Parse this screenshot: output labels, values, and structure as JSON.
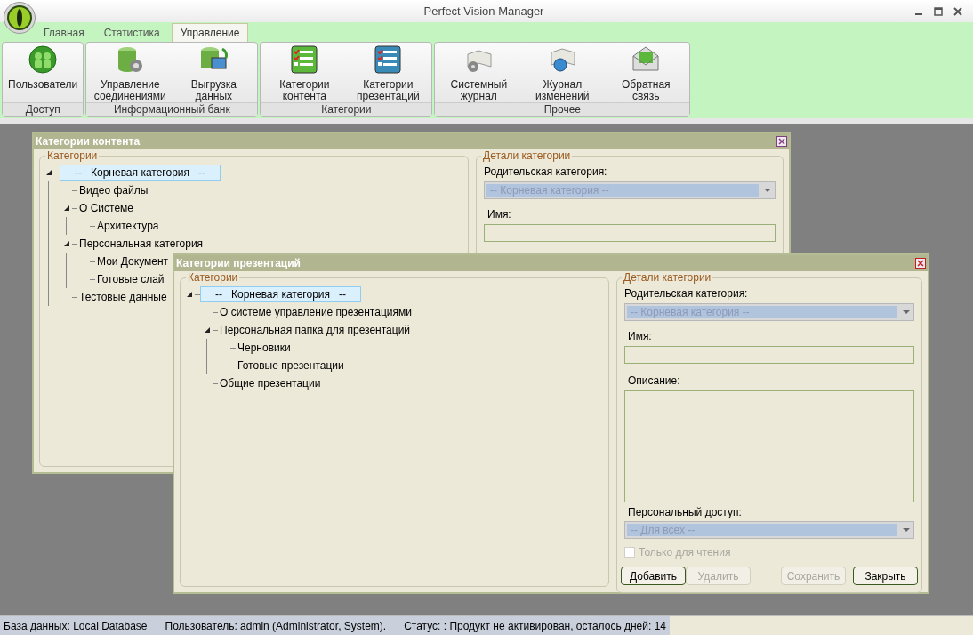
{
  "window": {
    "title": "Perfect Vision Manager"
  },
  "tabs": [
    {
      "label": "Главная",
      "selected": false
    },
    {
      "label": "Статистика",
      "selected": false
    },
    {
      "label": "Управление",
      "selected": true
    }
  ],
  "ribbon": [
    {
      "label": "Доступ",
      "buttons": [
        {
          "kind": "users",
          "label": "Пользователи"
        }
      ]
    },
    {
      "label": "Информационный банк",
      "buttons": [
        {
          "kind": "db-gear",
          "label": "Управление соединениями"
        },
        {
          "kind": "db-export",
          "label": "Выгрузка данных"
        }
      ]
    },
    {
      "label": "Категории",
      "buttons": [
        {
          "kind": "list-green",
          "label": "Категории контента"
        },
        {
          "kind": "list-blue",
          "label": "Категории презентаций"
        }
      ]
    },
    {
      "label": "Прочее",
      "buttons": [
        {
          "kind": "log",
          "label": "Системный журнал"
        },
        {
          "kind": "changes",
          "label": "Журнал изменений"
        },
        {
          "kind": "mail",
          "label": "Обратная связь"
        }
      ]
    }
  ],
  "windows": [
    {
      "title": "Категории контента",
      "tree_label": "Категории",
      "tree": [
        {
          "label": "--   Корневая категория   --",
          "selected": true,
          "expanded": true,
          "children": [
            {
              "label": "Видео файлы",
              "selected": false
            },
            {
              "label": "О Системе",
              "selected": false,
              "expanded": true,
              "children": [
                {
                  "label": "Архитектура",
                  "selected": false
                }
              ]
            },
            {
              "label": "Персональная категория",
              "selected": false,
              "expanded": true,
              "children": [
                {
                  "label": "Мои Документ",
                  "selected": false
                },
                {
                  "label": "Готовые слай",
                  "selected": false
                }
              ]
            },
            {
              "label": "Тестовые данные",
              "selected": false
            }
          ]
        }
      ],
      "details": {
        "label": "Детали категории",
        "parent_label": "Родительская категория:",
        "parent_value": "-- Корневая категория --",
        "name_label": "Имя:"
      }
    },
    {
      "title": "Категории презентаций",
      "tree_label": "Категории",
      "tree": [
        {
          "label": "--   Корневая категория   --",
          "selected": true,
          "expanded": true,
          "children": [
            {
              "label": "О системе управление презентациями",
              "selected": false
            },
            {
              "label": "Персональная папка для презентаций",
              "selected": false,
              "expanded": true,
              "children": [
                {
                  "label": "Черновики",
                  "selected": false
                },
                {
                  "label": "Готовые презентации",
                  "selected": false
                }
              ]
            },
            {
              "label": "Общие презентации",
              "selected": false
            }
          ]
        }
      ],
      "details": {
        "label": "Детали категории",
        "parent_label": "Родительская категория:",
        "parent_value": "-- Корневая категория --",
        "name_label": "Имя:",
        "description_label": "Описание:",
        "access_label": "Персональный доступ:",
        "access_value": "-- Для всех --",
        "readonly": {
          "label": "Только для чтения",
          "checked": false,
          "disabled": true
        },
        "buttons": [
          {
            "label": "Добавить",
            "disabled": false
          },
          {
            "label": "Удалить",
            "disabled": true
          },
          {
            "label": "Сохранить",
            "disabled": true
          },
          {
            "label": "Закрыть",
            "disabled": false
          }
        ]
      }
    }
  ],
  "status_bar": [
    "База данных: Local Database",
    "Пользователь: admin (Administrator, System).",
    "Статус: : Продукт не активирован, осталось дней: 14"
  ]
}
